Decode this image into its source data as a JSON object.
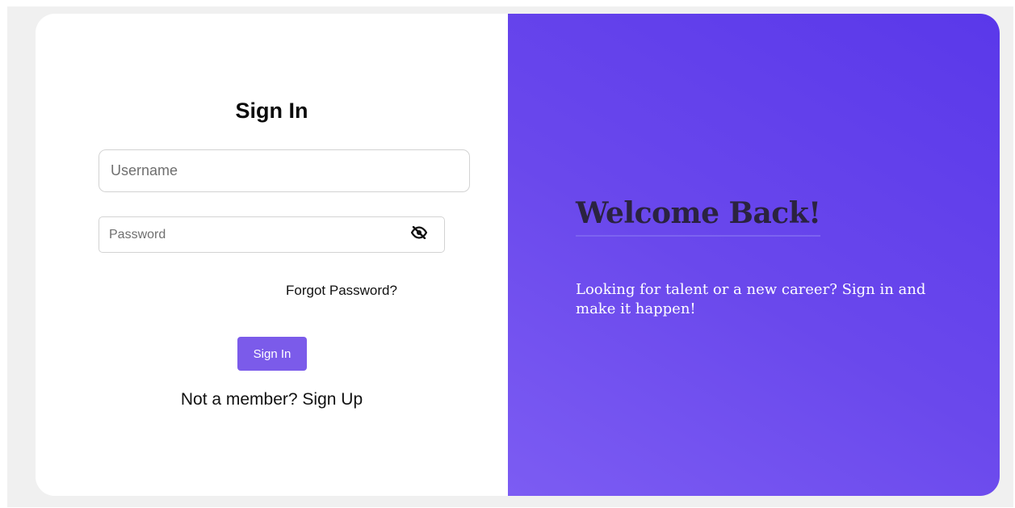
{
  "signin": {
    "title": "Sign In",
    "username_placeholder": "Username",
    "password_placeholder": "Password",
    "password_toggle_icon": "eye-slash-icon",
    "forgot_password": "Forgot Password?",
    "submit_label": "Sign In",
    "signup_prompt": "Not a member?",
    "signup_link": "Sign Up"
  },
  "promo": {
    "heading": "Welcome Back!",
    "tagline": "Looking for talent or a new career? Sign in and make it happen!"
  },
  "colors": {
    "accent": "#7b5bea",
    "panel_gradient_start": "#7c5cf3",
    "panel_gradient_end": "#5a38ea",
    "heading_text": "#2b2340"
  }
}
